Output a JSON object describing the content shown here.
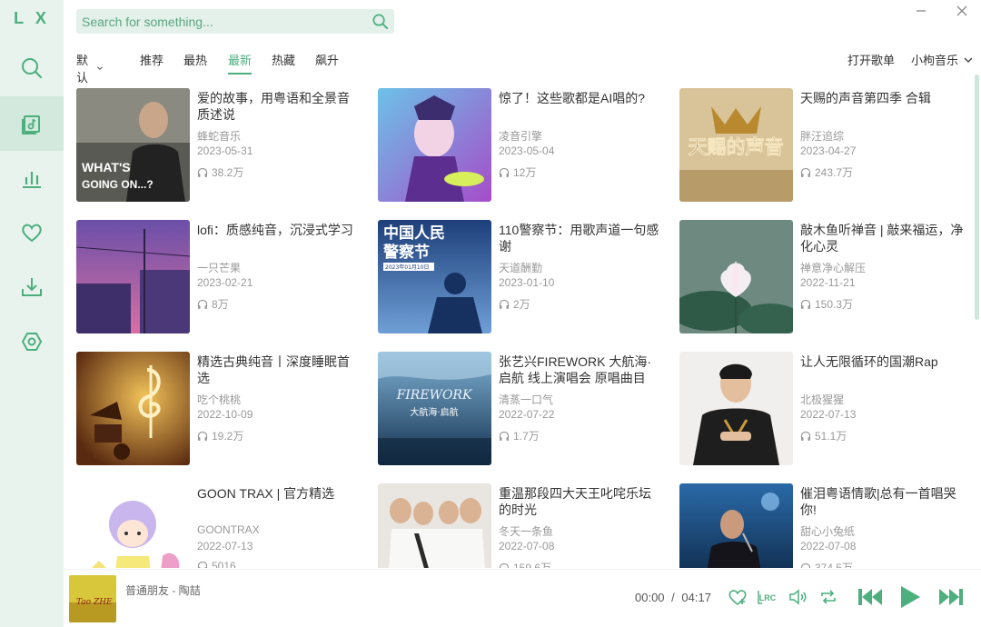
{
  "app": {
    "logo": "L X"
  },
  "search": {
    "placeholder": "Search for something..."
  },
  "filters": {
    "tag": "默认",
    "sorts": [
      "推荐",
      "最热",
      "最新",
      "热藏",
      "飙升"
    ],
    "active_sort": "最新",
    "open_songlist": "打开歌单",
    "source": "小枸音乐"
  },
  "playlists": [
    {
      "title": "爱的故事，用粤语和全景音质述说",
      "author": "蜂蛇音乐",
      "date": "2023-05-31",
      "plays": "38.2万"
    },
    {
      "title": "惊了！这些歌都是AI唱的?",
      "author": "凌音引擎",
      "date": "2023-05-04",
      "plays": "12万"
    },
    {
      "title": "天赐的声音第四季 合辑",
      "author": "胖汪追综",
      "date": "2023-04-27",
      "plays": "243.7万"
    },
    {
      "title": "lofi：质感纯音，沉浸式学习",
      "author": "一只芒果",
      "date": "2023-02-21",
      "plays": "8万"
    },
    {
      "title": "110警察节：用歌声道一句感谢",
      "author": "天道酬勤",
      "date": "2023-01-10",
      "plays": "2万"
    },
    {
      "title": "敲木鱼听禅音 | 敲来福运，净化心灵",
      "author": "禅意净心解压",
      "date": "2022-11-21",
      "plays": "150.3万"
    },
    {
      "title": "精选古典纯音丨深度睡眠首选",
      "author": "吃个桃桃",
      "date": "2022-10-09",
      "plays": "19.2万"
    },
    {
      "title": "张艺兴FIREWORK 大航海·启航 线上演唱会 原唱曲目",
      "author": "清蒸一口气",
      "date": "2022-07-22",
      "plays": "1.7万"
    },
    {
      "title": "让人无限循环的国潮Rap",
      "author": "北极猩猩",
      "date": "2022-07-13",
      "plays": "51.1万"
    },
    {
      "title": "GOON TRAX | 官方精选",
      "author": "GOONTRAX",
      "date": "2022-07-13",
      "plays": "5016"
    },
    {
      "title": "重温那段四大天王叱咤乐坛的时光",
      "author": "冬天一条鱼",
      "date": "2022-07-08",
      "plays": "159.6万"
    },
    {
      "title": "催泪粤语情歌|总有一首唱哭你!",
      "author": "甜心小兔纸",
      "date": "2022-07-08",
      "plays": "374.5万"
    }
  ],
  "covers": {
    "c1": {
      "text1": "WHAT'S",
      "text2": "GOING ON...?"
    },
    "c3": {
      "text": "天赐的声音"
    },
    "c5": {
      "line1": "中国人民",
      "line2": "警察节",
      "date": "2023年01月10日"
    },
    "c8": {
      "title": "FIREWORK",
      "subtitle": "大航海·启航"
    }
  },
  "player": {
    "song": "普通朋友 - 陶喆",
    "current": "00:00",
    "separator": "/",
    "duration": "04:17",
    "lrc_label": "LRC",
    "cover_text": "Tao ZHE"
  },
  "colors": {
    "accent": "#4caf7d",
    "sidebar_bg": "#e8f3ee",
    "search_bg": "#e3f1ea"
  },
  "icons": {
    "nav": [
      "search-icon",
      "songlist-icon",
      "leaderboard-icon",
      "heart-icon",
      "download-icon",
      "settings-icon"
    ],
    "window": [
      "minimize-icon",
      "close-icon"
    ],
    "player": [
      "favorite-icon",
      "lyrics-icon",
      "volume-icon",
      "loop-icon",
      "previous-icon",
      "play-icon",
      "next-icon"
    ]
  }
}
